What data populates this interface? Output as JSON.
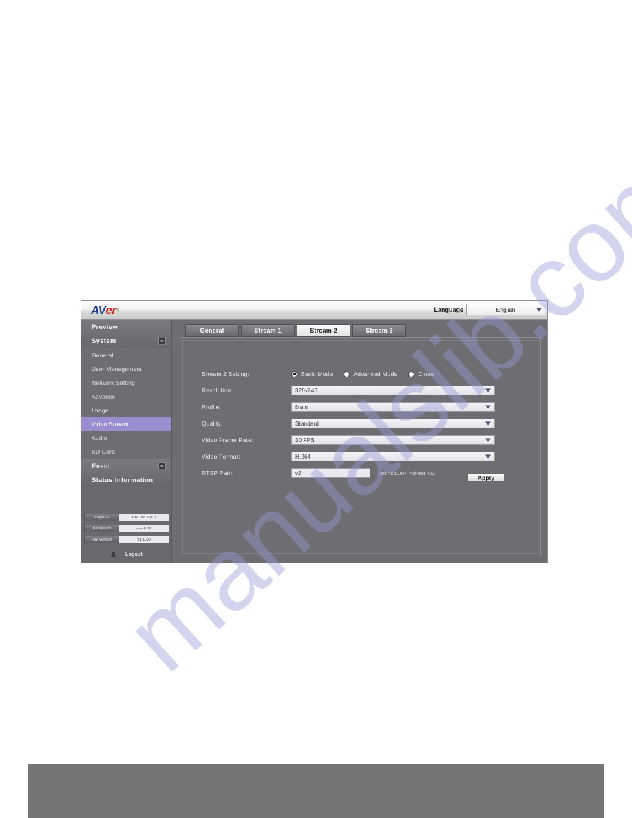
{
  "header": {
    "logo": {
      "part1": "AV",
      "part2": "e",
      "part3": "r",
      "tm": "®"
    },
    "language_label": "Language",
    "language_value": "English",
    "caret_icon": "chevron-down-icon"
  },
  "sidebar": {
    "preview": "Preview",
    "system": "System",
    "system_expander": "−",
    "items": [
      {
        "label": "General",
        "active": false
      },
      {
        "label": "User Management",
        "active": false
      },
      {
        "label": "Network Setting",
        "active": false
      },
      {
        "label": "Advance",
        "active": false
      },
      {
        "label": "Image",
        "active": false
      },
      {
        "label": "Video Stream",
        "active": true
      },
      {
        "label": "Audio",
        "active": false
      },
      {
        "label": "SD Card",
        "active": false
      }
    ],
    "event": "Event",
    "event_expander": "+",
    "status_information": "Status Information",
    "status": [
      {
        "label": "Login IP",
        "value": "192.168.201.1"
      },
      {
        "label": "Bandwidth",
        "value": "----- Kb/s"
      },
      {
        "label": "FW Version",
        "value": "V1.0.00"
      }
    ],
    "logout_label": "Logout",
    "logout_icon": "person-icon"
  },
  "tabs": [
    {
      "label": "General",
      "active": false
    },
    {
      "label": "Stream 1",
      "active": false
    },
    {
      "label": "Stream 2",
      "active": true
    },
    {
      "label": "Stream 3",
      "active": false
    }
  ],
  "form": {
    "stream_setting": {
      "label": "Stream 2 Setting:",
      "options": [
        {
          "label": "Basic Mode",
          "checked": true
        },
        {
          "label": "Advanced Mode",
          "checked": false
        },
        {
          "label": "Close",
          "checked": false
        }
      ]
    },
    "resolution": {
      "label": "Resolution:",
      "value": "320x240"
    },
    "profile": {
      "label": "Profile:",
      "value": "Main"
    },
    "quality": {
      "label": "Quality:",
      "value": "Standard"
    },
    "video_frame_rate": {
      "label": "Video Frame Rate:",
      "value": "30 FPS"
    },
    "video_format": {
      "label": "Video Format:",
      "value": "H.264"
    },
    "rtsp_path": {
      "label": "RTSP Path:",
      "value": "v2",
      "hint": "ex:rtsp://IP_Adress /v2"
    },
    "apply_label": "Apply"
  },
  "watermark": {
    "text": "manualslib.com"
  },
  "colors": {
    "accent_purple": "#9b8ed0",
    "panel_gray": "#6e6e72",
    "sidebar_gray": "#6a6a6e",
    "footer_gray": "#757577",
    "logo_blue": "#1f3f8f",
    "logo_red": "#c92b20",
    "watermark": "#9a9ad8"
  }
}
